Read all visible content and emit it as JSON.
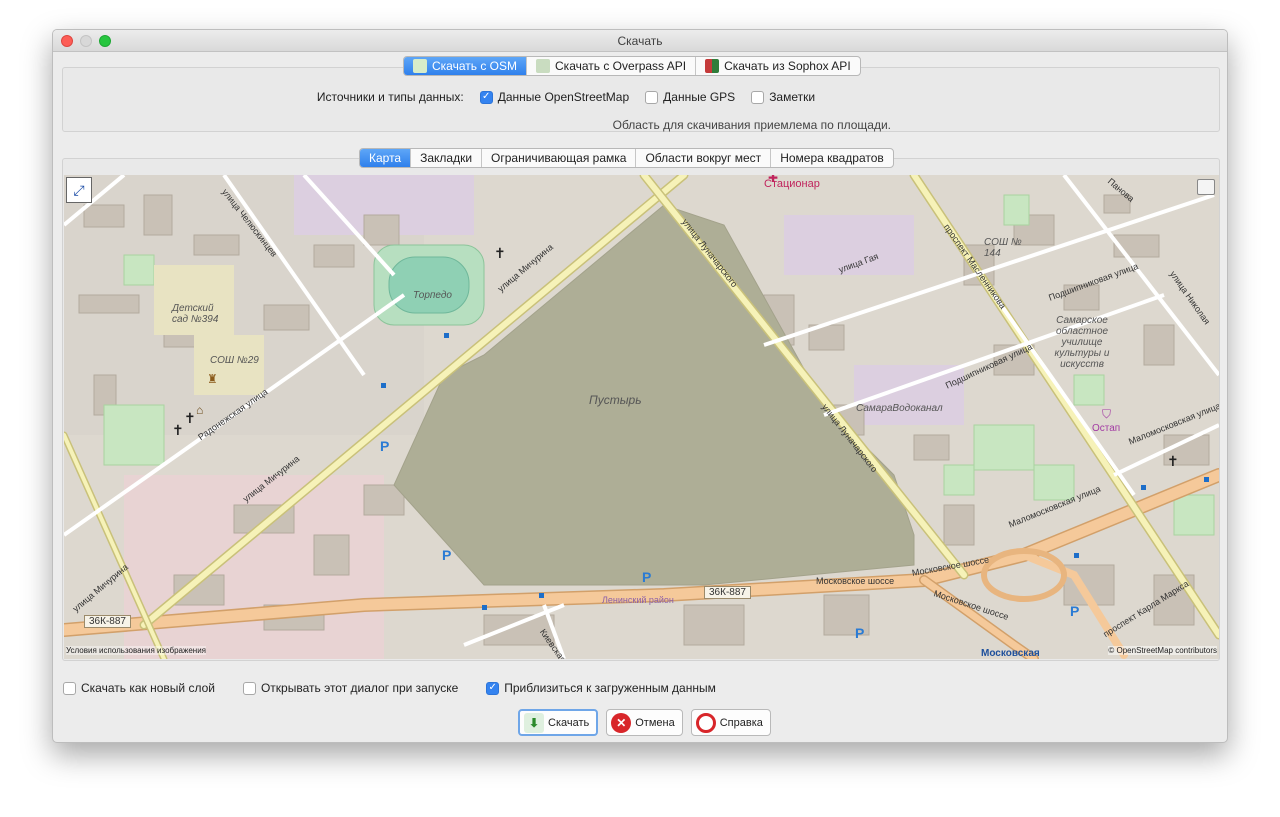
{
  "window": {
    "title": "Скачать"
  },
  "top_tabs": [
    {
      "label": "Скачать с OSM",
      "active": true,
      "icon": "osm-download-icon"
    },
    {
      "label": "Скачать с Overpass API",
      "active": false,
      "icon": "overpass-icon"
    },
    {
      "label": "Скачать из Sophox API",
      "active": false,
      "icon": "sophox-icon"
    }
  ],
  "sources": {
    "label": "Источники и типы данных:",
    "osm": {
      "label": "Данные OpenStreetMap",
      "checked": true
    },
    "gps": {
      "label": "Данные GPS",
      "checked": false
    },
    "notes": {
      "label": "Заметки",
      "checked": false
    },
    "status": "Область для скачивания приемлема по площади."
  },
  "map_tabs": [
    {
      "label": "Карта",
      "active": true
    },
    {
      "label": "Закладки",
      "active": false
    },
    {
      "label": "Ограничивающая рамка",
      "active": false
    },
    {
      "label": "Области вокруг мест",
      "active": false
    },
    {
      "label": "Номера квадратов",
      "active": false
    }
  ],
  "map": {
    "labels": {
      "pustyr": "Пустырь",
      "torpedo": "Торпедо",
      "kindergarten": "Детский сад №394",
      "school29": "СОШ №29",
      "school144": "СОШ № 144",
      "college": "Самарское областное училище культуры и искусств",
      "samaravodokanal": "СамараВодоканал",
      "ostap": "Остап",
      "stacionar": "Стационар",
      "district": "Ленинский район",
      "metro": "Московская"
    },
    "streets": {
      "michurina_1": "улица Мичурина",
      "michurina_2": "улица Мичурина",
      "michurina_3": "улица Мичурина",
      "chelyuskincev": "улица Челюскинцев",
      "lunacharskogo_1": "улица Луначарского",
      "lunacharskogo_2": "улица Луначарского",
      "radonezhskaya": "Радонежская улица",
      "gaya": "улица Гая",
      "maslennikova": "проспект Масленникова",
      "podshipnikovaya_1": "Подшипниковая улица",
      "podshipnikovaya_2": "Подшипниковая улица",
      "malomoskovskaya_1": "Маломосковская улица",
      "malomoskovskaya_2": "Маломосковская улица",
      "moskovskoe_1": "Московское шоссе",
      "moskovskoe_2": "Московское шоссе",
      "moskovskoe_3": "Московское шоссе",
      "karla_marksa": "проспект Карла Маркса",
      "kievskaya": "Киевская",
      "panova": "Панова",
      "nikolaya": "улица Николая"
    },
    "road_refs": [
      "36К-887",
      "36К-887"
    ],
    "parking_symbol": "P",
    "attribution_left": "Условия использования изображения",
    "attribution_right": "© OpenStreetMap contributors"
  },
  "options": {
    "new_layer": {
      "label": "Скачать как новый слой",
      "checked": false
    },
    "open_on_start": {
      "label": "Открывать этот диалог при запуске",
      "checked": false
    },
    "zoom_to_data": {
      "label": "Приблизиться к загруженным данным",
      "checked": true
    }
  },
  "buttons": {
    "download": "Скачать",
    "cancel": "Отмена",
    "help": "Справка"
  }
}
